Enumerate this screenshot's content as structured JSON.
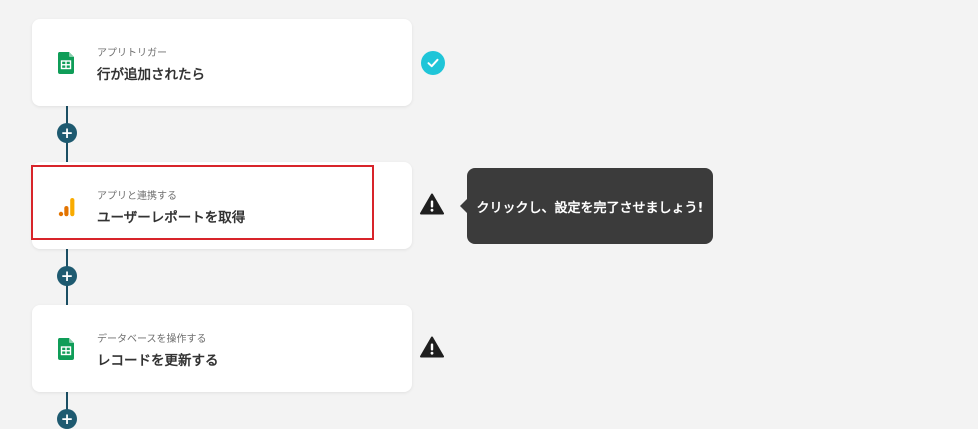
{
  "steps": [
    {
      "subtitle": "アプリトリガー",
      "title": "行が追加されたら",
      "icon": "google-sheets-icon",
      "status": "complete"
    },
    {
      "subtitle": "アプリと連携する",
      "title": "ユーザーレポートを取得",
      "icon": "google-analytics-icon",
      "status": "warning"
    },
    {
      "subtitle": "データベースを操作する",
      "title": "レコードを更新する",
      "icon": "google-sheets-icon",
      "status": "warning"
    }
  ],
  "add_step_symbol": "+",
  "tooltip": {
    "text": "クリックし、設定を完了させましょう!"
  },
  "colors": {
    "connector": "#1a4e63",
    "check": "#1fc5d8",
    "highlight": "#d8242a",
    "sheets_green": "#0f9d58",
    "analytics_orange": "#f9ab00",
    "tooltip_bg": "#3b3b3b"
  }
}
